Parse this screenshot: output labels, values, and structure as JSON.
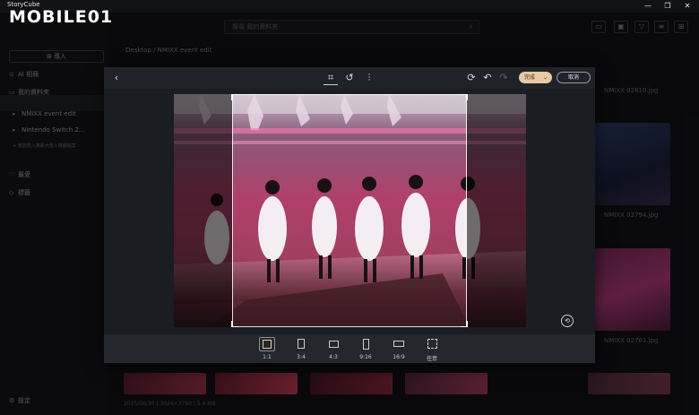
{
  "app": {
    "title": "StoryCube",
    "watermark": "MOBILE01"
  },
  "window_controls": {
    "minimize": "—",
    "maximize": "❐",
    "close": "✕"
  },
  "search": {
    "placeholder": "搜尋 我的資料夾"
  },
  "sidebar": {
    "import_label": "⊞ 導入",
    "items": [
      {
        "label": "AI 相冊",
        "icon": "ai-album-icon"
      },
      {
        "label": "我的資料夾",
        "icon": "folder-icon"
      },
      {
        "label": "NMIXX event edit",
        "icon": "folder-icon"
      },
      {
        "label": "Nintendo Switch 2...",
        "icon": "folder-icon"
      },
      {
        "label": "+ 當前匯入將最大匯入媒體檔案",
        "icon": ""
      },
      {
        "label": "最愛",
        "icon": "heart-icon"
      },
      {
        "label": "標籤",
        "icon": "tag-icon"
      },
      {
        "label": "設定",
        "icon": "gear-icon"
      }
    ]
  },
  "breadcrumb": {
    "text": "Desktop / NMIXX event edit"
  },
  "gallery": {
    "files": [
      "NMIXX 02610.jpg",
      "NMIXX 02794.jpg",
      "NMIXX 02761.jpg"
    ],
    "status": "2025/06/30 | 3024×3760 | 5.4 MB"
  },
  "editor": {
    "done_label": "完成",
    "cancel_label": "取消",
    "ratios": [
      {
        "label": "1:1",
        "w": 1,
        "h": 1,
        "active": true
      },
      {
        "label": "3:4",
        "w": 3,
        "h": 4,
        "active": false
      },
      {
        "label": "4:3",
        "w": 4,
        "h": 3,
        "active": false
      },
      {
        "label": "9:16",
        "w": 9,
        "h": 16,
        "active": false
      },
      {
        "label": "16:9",
        "w": 16,
        "h": 9,
        "active": false
      },
      {
        "label": "任意",
        "w": 0,
        "h": 0,
        "active": false
      }
    ]
  },
  "colors": {
    "accent": "#e9c9a4",
    "background": "#111214",
    "modal": "#1d2126"
  }
}
